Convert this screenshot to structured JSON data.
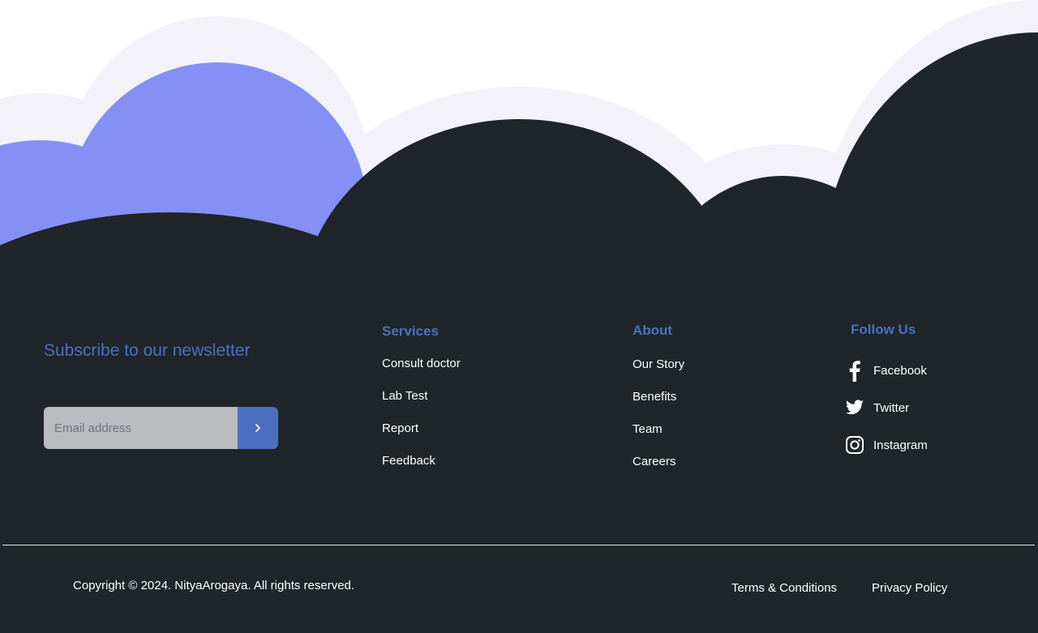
{
  "newsletter": {
    "title": "Subscribe to our newsletter",
    "placeholder": "Email address",
    "submit_icon": "chevron-right-icon"
  },
  "services": {
    "heading": "Services",
    "items": [
      "Consult doctor",
      "Lab Test",
      "Report",
      "Feedback"
    ]
  },
  "about": {
    "heading": "About",
    "items": [
      "Our Story",
      "Benefits",
      "Team",
      "Careers"
    ]
  },
  "follow": {
    "heading": "Follow Us",
    "items": [
      {
        "label": "Facebook",
        "icon": "facebook-icon"
      },
      {
        "label": "Twitter",
        "icon": "twitter-icon"
      },
      {
        "label": "Instagram",
        "icon": "instagram-icon"
      }
    ]
  },
  "bottom": {
    "copyright": "Copyright © 2024. NityaArogaya. All rights reserved.",
    "terms": "Terms & Conditions",
    "privacy": "Privacy Policy"
  },
  "colors": {
    "footer_bg": "#1f2528",
    "accent": "#4a72c0",
    "cloud_periwinkle": "#8590f4",
    "cloud_light": "#f3f2f8",
    "button": "#4a6fbf",
    "input_bg": "#b9bbbe"
  }
}
